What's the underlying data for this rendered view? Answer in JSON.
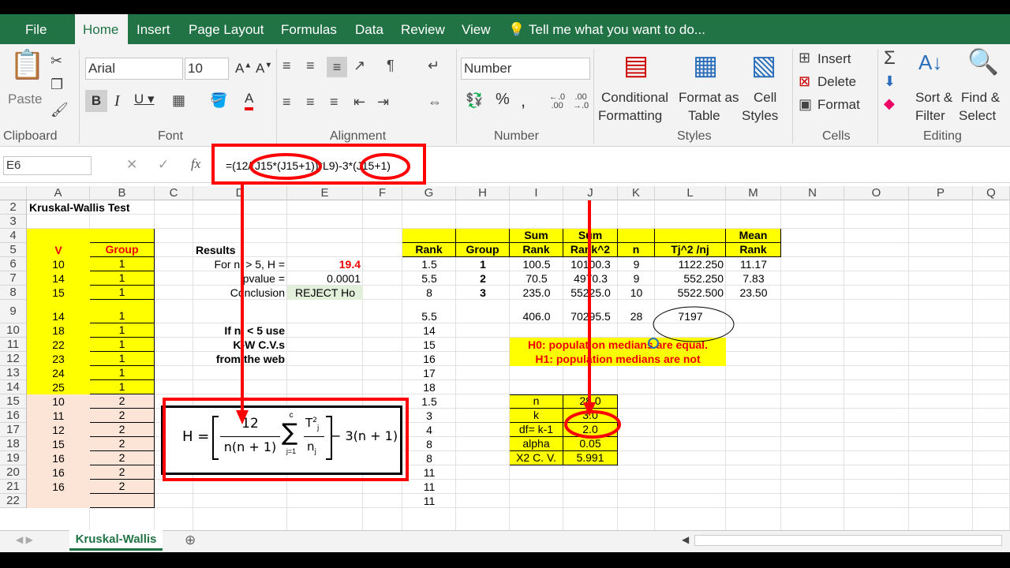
{
  "tabs": [
    "File",
    "Home",
    "Insert",
    "Page Layout",
    "Formulas",
    "Data",
    "Review",
    "View"
  ],
  "tell_me": "Tell me what you want to do...",
  "ribbon": {
    "paste": "Paste",
    "font_name": "Arial",
    "font_size": "10",
    "number_format": "Number",
    "conditional_formatting_1": "Conditional",
    "conditional_formatting_2": "Formatting",
    "format_table_1": "Format as",
    "format_table_2": "Table",
    "cell_styles_1": "Cell",
    "cell_styles_2": "Styles",
    "insert": "Insert",
    "delete": "Delete",
    "format": "Format",
    "sort_1": "Sort &",
    "sort_2": "Filter",
    "find_1": "Find &",
    "find_2": "Select",
    "groups": [
      "Clipboard",
      "Font",
      "Alignment",
      "Number",
      "Styles",
      "Cells",
      "Editing"
    ]
  },
  "formula_bar": {
    "name_box": "E6",
    "fx": "fx",
    "formula": "=(12/(J15*(J15+1))*L9)-3*(J15+1)"
  },
  "columns": [
    "A",
    "B",
    "C",
    "D",
    "E",
    "F",
    "G",
    "H",
    "I",
    "J",
    "K",
    "L",
    "M",
    "N",
    "O",
    "P",
    "Q"
  ],
  "rows": [
    "2",
    "3",
    "4",
    "5",
    "6",
    "7",
    "8",
    "9",
    "10",
    "11",
    "12",
    "13",
    "14",
    "15",
    "16",
    "17",
    "18",
    "19",
    "20",
    "21",
    "22"
  ],
  "title": "Kruskal-Wallis Test",
  "v_header": "V",
  "group_header": "Group",
  "v_values": [
    "10",
    "14",
    "15",
    "14",
    "18",
    "22",
    "23",
    "24",
    "25",
    "10",
    "11",
    "12",
    "15",
    "16",
    "16",
    "16"
  ],
  "group_values": [
    "1",
    "1",
    "1",
    "1",
    "1",
    "1",
    "1",
    "1",
    "1",
    "2",
    "2",
    "2",
    "2",
    "2",
    "2",
    "2"
  ],
  "results": {
    "label": "Results",
    "h_label": "For ni > 5, H =",
    "h_value": "19.4",
    "p_label": "pvalue =",
    "p_value": "0.0001",
    "c_label": "Conclusion",
    "c_value": "REJECT Ho",
    "lt5": "If ni < 5 use",
    "kw": "K-W C.V.s",
    "web": "from the web"
  },
  "rank_table": {
    "headers": [
      [
        "",
        "Rank"
      ],
      [
        "",
        "Group"
      ],
      [
        "Sum",
        "Rank"
      ],
      [
        "Sum",
        "Rank^2"
      ],
      [
        "",
        "n"
      ],
      [
        "",
        "Tj^2 /nj"
      ],
      [
        "Mean",
        "Rank"
      ]
    ],
    "rows": [
      [
        "1.5",
        "1",
        "100.5",
        "10100.3",
        "9",
        "1122.250",
        "11.17"
      ],
      [
        "5.5",
        "2",
        "70.5",
        "4970.3",
        "9",
        "552.250",
        "7.83"
      ],
      [
        "8",
        "3",
        "235.0",
        "55225.0",
        "10",
        "5522.500",
        "23.50"
      ]
    ],
    "total": [
      "5.5",
      "",
      "406.0",
      "70295.5",
      "28",
      "7197",
      ""
    ],
    "more_ranks": [
      "14",
      "15",
      "16",
      "17",
      "18",
      "1.5",
      "3",
      "4",
      "8",
      "8",
      "11",
      "11",
      "11"
    ]
  },
  "hypotheses": {
    "h0": "H0: population medians are equal.",
    "h1": "H1: population medians are not"
  },
  "stats": [
    [
      "n",
      "28.0"
    ],
    [
      "k",
      "3.0"
    ],
    [
      "df= k-1",
      "2.0"
    ],
    [
      "alpha",
      "0.05"
    ],
    [
      "X2 C. V.",
      "5.991"
    ]
  ],
  "formula_img": {
    "lhs": "H =",
    "num": "12",
    "den": "n(n + 1)",
    "sum_top": "c",
    "sum_bot": "j=1",
    "tj": "T",
    "tj_sub": "j",
    "tj_sup": "2",
    "nj": "n",
    "nj_sub": "j",
    "rhs": "− 3(n + 1)"
  },
  "sheet_tab": "Kruskal-Wallis",
  "colors": {
    "excel_green": "#217346",
    "annotation_red": "#ff0000",
    "cell_yellow": "#ffff00",
    "cell_peach": "#fce4d6"
  }
}
